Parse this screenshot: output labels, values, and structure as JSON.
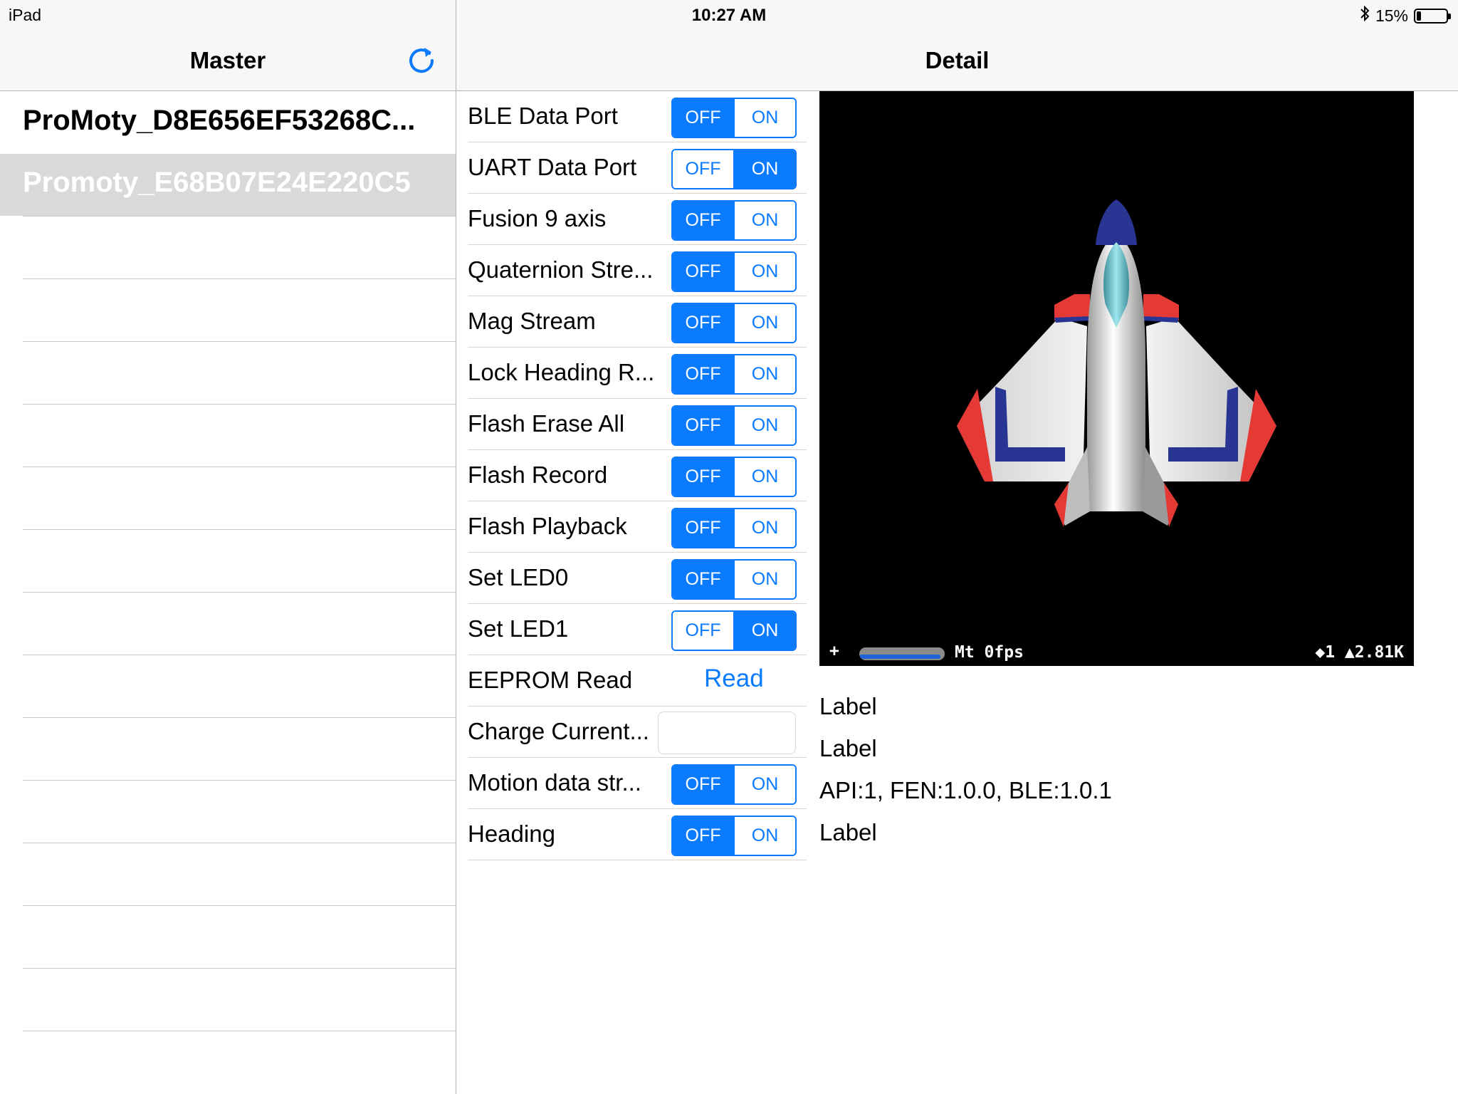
{
  "status_bar": {
    "device": "iPad",
    "time": "10:27 AM",
    "battery_text": "15%",
    "battery_level": 0.15
  },
  "master": {
    "title": "Master",
    "refresh_icon": "refresh-icon",
    "devices": [
      {
        "name": "ProMoty_D8E656EF53268C...",
        "selected": false
      },
      {
        "name": "Promoty_E68B07E24E220C5",
        "selected": true
      }
    ]
  },
  "detail": {
    "title": "Detail",
    "settings": [
      {
        "label": "BLE Data Port",
        "type": "segmented",
        "options": [
          "OFF",
          "ON"
        ],
        "selected": "OFF"
      },
      {
        "label": "UART Data Port",
        "type": "segmented",
        "options": [
          "OFF",
          "ON"
        ],
        "selected": "ON"
      },
      {
        "label": "Fusion 9 axis",
        "type": "segmented",
        "options": [
          "OFF",
          "ON"
        ],
        "selected": "OFF"
      },
      {
        "label": "Quaternion Stre...",
        "type": "segmented",
        "options": [
          "OFF",
          "ON"
        ],
        "selected": "OFF"
      },
      {
        "label": "Mag Stream",
        "type": "segmented",
        "options": [
          "OFF",
          "ON"
        ],
        "selected": "OFF"
      },
      {
        "label": "Lock Heading R...",
        "type": "segmented",
        "options": [
          "OFF",
          "ON"
        ],
        "selected": "OFF"
      },
      {
        "label": "Flash Erase All",
        "type": "segmented",
        "options": [
          "OFF",
          "ON"
        ],
        "selected": "OFF"
      },
      {
        "label": "Flash Record",
        "type": "segmented",
        "options": [
          "OFF",
          "ON"
        ],
        "selected": "OFF"
      },
      {
        "label": "Flash Playback",
        "type": "segmented",
        "options": [
          "OFF",
          "ON"
        ],
        "selected": "OFF"
      },
      {
        "label": "Set LED0",
        "type": "segmented",
        "options": [
          "OFF",
          "ON"
        ],
        "selected": "OFF"
      },
      {
        "label": "Set LED1",
        "type": "segmented",
        "options": [
          "OFF",
          "ON"
        ],
        "selected": "ON"
      },
      {
        "label": "EEPROM Read",
        "type": "button",
        "button_label": "Read"
      },
      {
        "label": "Charge Current...",
        "type": "textfield",
        "value": "",
        "placeholder": ""
      },
      {
        "label": "Motion data str...",
        "type": "segmented",
        "options": [
          "OFF",
          "ON"
        ],
        "selected": "OFF"
      },
      {
        "label": "Heading",
        "type": "segmented",
        "options": [
          "OFF",
          "ON"
        ],
        "selected": "OFF"
      }
    ],
    "scene": {
      "stats_plus": "+",
      "stats_fps": "Mt 0fps",
      "stats_right": "◆1 ▲2.81K",
      "gauge_level": 0.95
    },
    "info_labels": [
      "Label",
      "Label",
      "API:1, FEN:1.0.0, BLE:1.0.1",
      "Label"
    ]
  },
  "colors": {
    "accent": "#0a7aff",
    "selected_row": "#d9d9d9",
    "scene_bg": "#000000"
  }
}
